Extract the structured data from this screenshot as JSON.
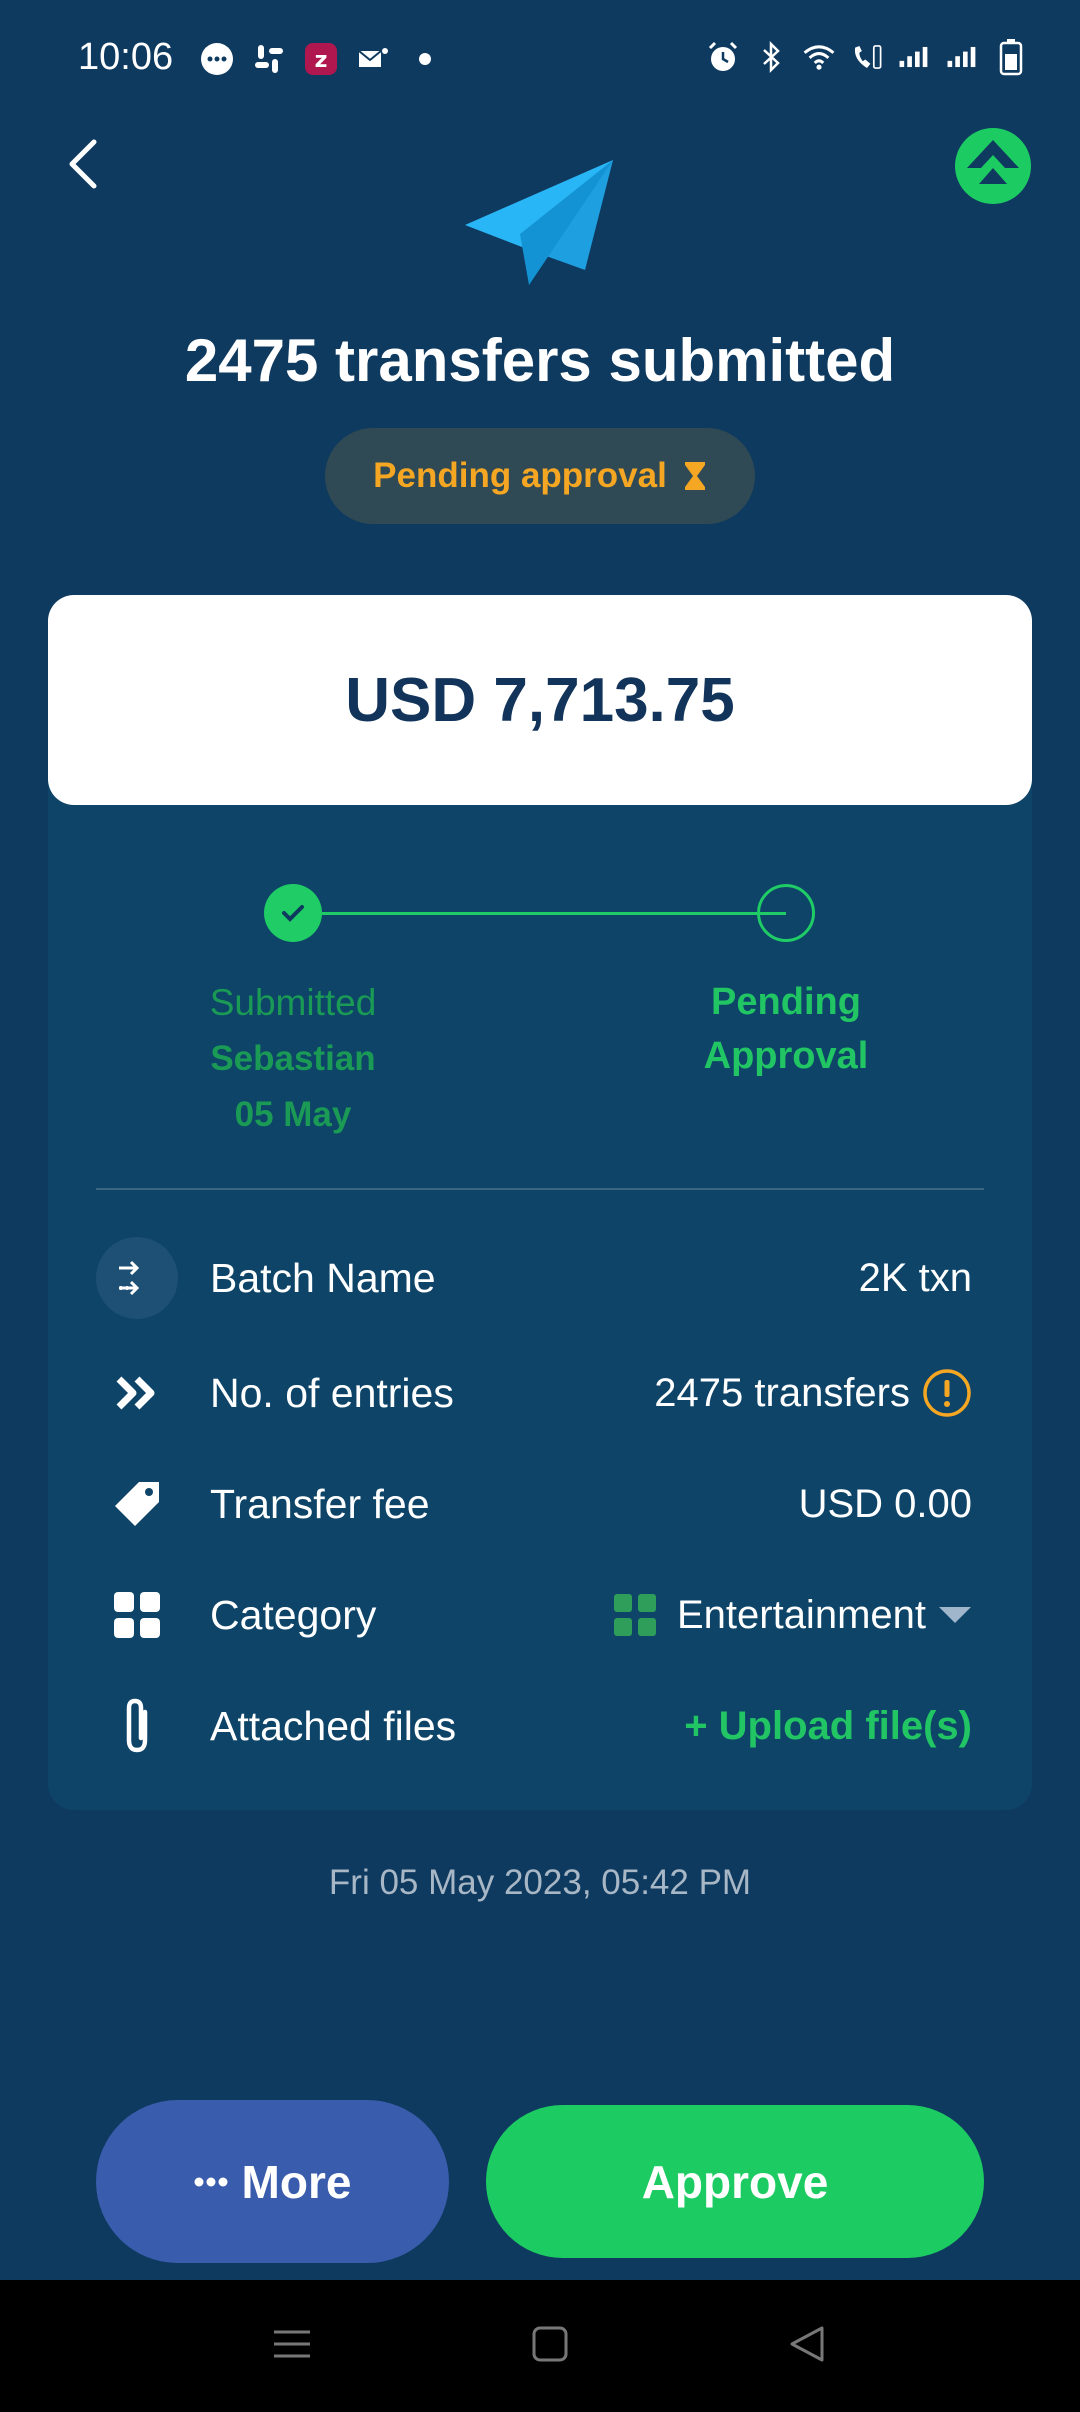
{
  "status_bar": {
    "time": "10:06",
    "left_icons": [
      "messages-icon",
      "slack-icon",
      "zoho-icon",
      "mail-icon",
      "dot-icon"
    ],
    "right_icons": [
      "alarm-icon",
      "bluetooth-icon",
      "wifi-icon",
      "wifi-calling-icon",
      "signal-icon",
      "signal-icon",
      "battery-icon"
    ]
  },
  "header": {
    "back_icon": "chevron-left-icon",
    "logo_icon": "brand-logo-icon",
    "hero_icon": "paper-plane-icon",
    "title": "2475 transfers submitted",
    "status_pill": {
      "label": "Pending approval",
      "icon": "hourglass-icon"
    }
  },
  "amount": "USD 7,713.75",
  "timeline": {
    "steps": [
      {
        "status": "Submitted",
        "by": "Sebastian",
        "date": "05 May"
      },
      {
        "status_line1": "Pending",
        "status_line2": "Approval"
      }
    ]
  },
  "details": [
    {
      "icon": "transfer-arrows-icon",
      "label": "Batch Name",
      "value": "2K txn"
    },
    {
      "icon": "double-chevron-icon",
      "label": "No. of entries",
      "value": "2475 transfers",
      "value_icon": "warning-circle-icon"
    },
    {
      "icon": "price-tag-icon",
      "label": "Transfer fee",
      "value": "USD 0.00"
    },
    {
      "icon": "grid-icon",
      "label": "Category",
      "value": "Entertainment",
      "value_icon": "dropdown-caret-icon"
    },
    {
      "icon": "paperclip-icon",
      "label": "Attached files",
      "value": "+ Upload file(s)"
    }
  ],
  "timestamp": "Fri 05 May 2023, 05:42 PM",
  "actions": {
    "more": "More",
    "more_icon": "ellipsis-icon",
    "approve": "Approve"
  },
  "colors": {
    "background": "#0f3a5f",
    "accent_green": "#1ccc62",
    "pending_orange": "#f5a623",
    "more_button": "#3a5cac"
  },
  "navbar": [
    "menu-icon",
    "home-square-icon",
    "back-triangle-icon"
  ]
}
